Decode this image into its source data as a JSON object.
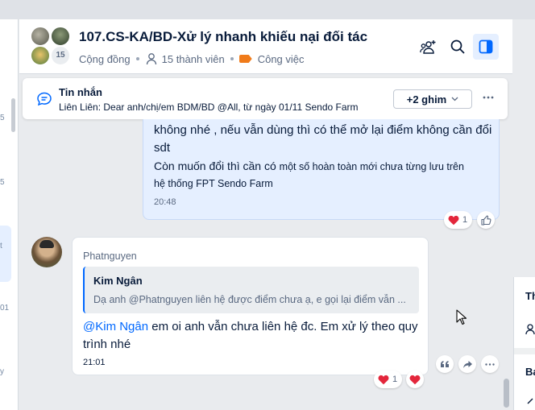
{
  "conversation": {
    "title": "107.CS-KA/BD-Xử lý nhanh khiếu nại đối tác",
    "type": "Cộng đồng",
    "members": "15 thành viên",
    "label": "Công việc",
    "avatar_count": "15",
    "label_color": "#f07b1a"
  },
  "left_fragments": [
    "5",
    "5",
    "t",
    "01",
    "y"
  ],
  "right_fragments": [
    "Th",
    "Ba"
  ],
  "pinned": {
    "title": "Tin nhắn",
    "preview": "Liên Liên: Dear anh/chị/em BDM/BD @All, từ ngày 01/11 Sendo Farm",
    "more_label": "+2 ghim"
  },
  "messages": {
    "outgoing": {
      "line1": "không nhé , nếu vẫn dùng thì có thể mở lại điểm không cần đổi sdt",
      "line2": "Còn muốn đổi thì cần có",
      "line2_small": "một số hoàn toàn mới chưa từng lưu trên",
      "line3": "hệ thống FPT Sendo Farm",
      "time": "20:48",
      "heart_count": "1"
    },
    "incoming": {
      "sender": "Phatnguyen",
      "quote_name": "Kim Ngân",
      "quote_text": "Dạ anh @Phatnguyen liên hệ được điểm chưa ạ, e gọi lại điểm vẫn ...",
      "mention": "@Kim Ngân",
      "text": " em oi anh vẫn chưa liên hệ đc. Em xử lý theo quy trình nhé",
      "time": "21:01",
      "heart_count": "1"
    }
  },
  "colors": {
    "accent": "#0068ff",
    "outgoing_bg": "#e5efff",
    "heart": "#e3263b"
  }
}
